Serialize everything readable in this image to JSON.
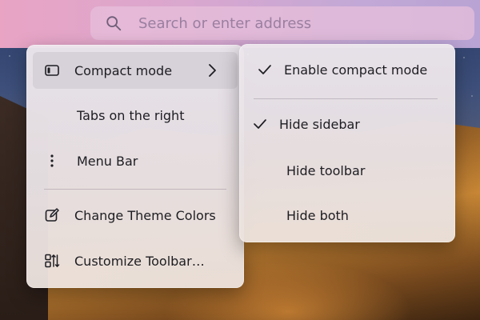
{
  "address_bar": {
    "placeholder": "Search or enter address",
    "icon": "search-icon"
  },
  "main_menu": {
    "items": [
      {
        "label": "Compact mode",
        "icon": "sidebar-panel-icon",
        "has_submenu": true,
        "highlighted": true
      },
      {
        "label": "Tabs on the right",
        "icon": ""
      },
      {
        "label": "Menu Bar",
        "icon": "vertical-dots-icon"
      },
      {
        "label": "Change Theme Colors",
        "icon": "edit-theme-icon"
      },
      {
        "label": "Customize Toolbar…",
        "icon": "customize-toolbar-icon"
      }
    ]
  },
  "submenu": {
    "items": [
      {
        "label": "Enable compact mode",
        "checked": true
      },
      {
        "label": "Hide sidebar",
        "checked": true
      },
      {
        "label": "Hide toolbar",
        "checked": false
      },
      {
        "label": "Hide both",
        "checked": false
      }
    ]
  },
  "colors": {
    "address_bar_gradient_start": "#e9a4c4",
    "address_bar_gradient_end": "#b8a3d4",
    "menu_background": "#ebe6ea",
    "text": "#1d1d22"
  }
}
